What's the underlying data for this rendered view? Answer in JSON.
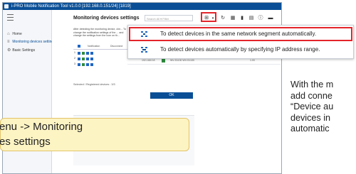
{
  "app": {
    "title": "i-PRO Mobile Notification Tool  v1.0.0 [192.168.0.151/24] [1819]"
  },
  "sidebar": {
    "items": [
      {
        "label": "Home"
      },
      {
        "label": "Monitoring devices settings"
      },
      {
        "label": "Basic Settings"
      }
    ]
  },
  "main": {
    "page_title": "Monitoring devices settings",
    "search_placeholder": "Search All   ▾   Filter",
    "description": "After detecting the monitoring device, che... To change the notification settings of the ... and change the settings from the Icon on th...",
    "table": {
      "headers": [
        "Notification",
        "Disconnect"
      ],
      "rows": [
        {
          "num": "1"
        },
        {
          "num": "2"
        },
        {
          "num": "3"
        }
      ]
    },
    "selected_text": "Selected / Registered devices : 3/3",
    "ok_label": "OK",
    "bg_row": {
      "ip": "192.168.0.8",
      "model": "WV-S1130 WV-S1130",
      "version": "1.00"
    }
  },
  "dropdown": {
    "items": [
      {
        "label": "To detect devices in the same network segment automatically."
      },
      {
        "label": "To detect devices automatically by specifying IP address range."
      }
    ]
  },
  "callout": {
    "line1": "enu -> Monitoring",
    "line2": "es settings"
  },
  "side_note": {
    "line1": "With the m",
    "line2": "add conne",
    "line3": "“Device au",
    "line4": "devices in",
    "line5": "automatic"
  },
  "colors": {
    "titlebar": "#0a4f96",
    "highlight_red": "#e4242b",
    "callout_bg": "#fdf4c4",
    "ok_button": "#0a4f96"
  }
}
